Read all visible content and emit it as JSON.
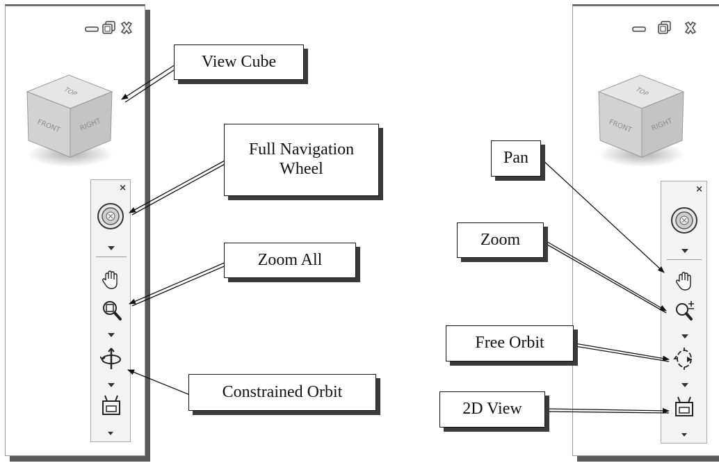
{
  "callouts": {
    "view_cube": "View Cube",
    "full_navigation_wheel": "Full Navigation\nWheel",
    "zoom_all": "Zoom All",
    "constrained_orbit": "Constrained Orbit",
    "pan": "Pan",
    "zoom": "Zoom",
    "free_orbit": "Free Orbit",
    "view_2d": "2D View"
  },
  "cube_faces": {
    "top": "TOP",
    "front": "FRONT",
    "right": "RIGHT"
  },
  "icons": {
    "minimize": "minimize-icon",
    "restore": "restore-icon",
    "close": "close-icon",
    "steering_wheel": "steering-wheel-icon",
    "pan": "pan-hand-icon",
    "zoom_all": "zoom-extents-icon",
    "zoom": "zoom-realtime-icon",
    "orbit_constrained": "constrained-orbit-icon",
    "orbit_free": "free-orbit-icon",
    "view_2d": "2d-view-icon"
  },
  "navbar_close": "×",
  "colors": {
    "shadow": "#5a5a5a",
    "cube": "#d9d9d9",
    "navbar": "#f3f3f3"
  }
}
